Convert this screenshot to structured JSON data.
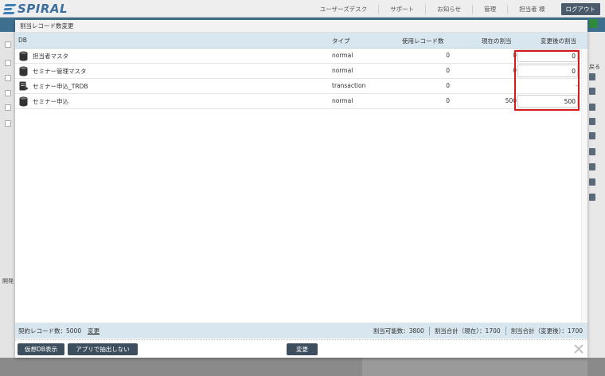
{
  "app": {
    "logo_text": "SPIRAL",
    "nav": [
      "ユーザーズデスク",
      "サポート",
      "お知らせ",
      "管理"
    ],
    "user_label": "担当者 様",
    "logout_label": "ログアウト",
    "side_label": "開発",
    "right_label": "戻る"
  },
  "dialog": {
    "title": "割当レコード数変更",
    "columns": {
      "db": "DB",
      "type": "タイプ",
      "used": "使用レコード数",
      "current": "現在の割当",
      "after": "変更後の割当"
    },
    "rows": [
      {
        "name": "担当者マスタ",
        "type": "normal",
        "used": "0",
        "current": "0",
        "after": "0",
        "icon": "database-icon"
      },
      {
        "name": "セミナー管理マスタ",
        "type": "normal",
        "used": "0",
        "current": "0",
        "after": "0",
        "icon": "database-icon"
      },
      {
        "name": "セミナー申込_TRDB",
        "type": "transaction",
        "used": "0",
        "current": "-",
        "after": "-",
        "icon": "transaction-db-icon"
      },
      {
        "name": "セミナー申込",
        "type": "normal",
        "used": "0",
        "current": "500",
        "after": "500",
        "icon": "database-icon"
      }
    ],
    "status": {
      "contract_label": "契約レコード数：5000",
      "change_link": "変更",
      "assignable": "割当可能数：3800",
      "total_current": "割当合計（現在）：1700",
      "total_after": "割当合計（変更後）：1700"
    },
    "buttons": {
      "virtual_db": "仮想DB表示",
      "app_no_extract": "アプリで抽出しない",
      "change": "変更"
    }
  },
  "colors": {
    "header_blue": "#d7e6ef",
    "button_dark": "#3d4f5f",
    "highlight_red": "#d21c1c",
    "dash_red": "#cf3a3a"
  }
}
